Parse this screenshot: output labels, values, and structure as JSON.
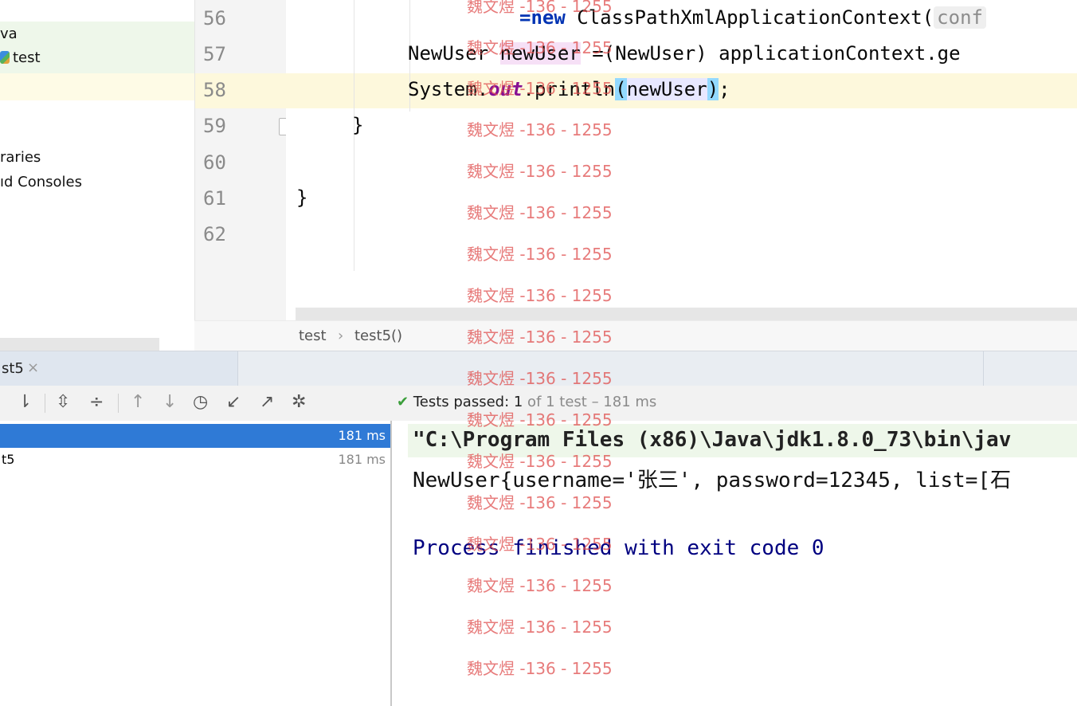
{
  "project_tree": {
    "items": [
      "va",
      "test",
      "raries",
      "ıd Consoles"
    ]
  },
  "editor": {
    "line_numbers": [
      "56",
      "57",
      "58",
      "59",
      "60",
      "61",
      "62"
    ],
    "line56_keyword": "=new",
    "line56_text": " ClassPathXmlApplicationContext(",
    "line56_hint": "conf",
    "line57_type": "NewUser ",
    "line57_var": "newUser",
    "line57_rest": " =(NewUser) applicationContext.ge",
    "line58_prefix": "System.",
    "line58_field": "out",
    "line58_method": ".println",
    "line58_open": "(",
    "line58_arg": "newUser",
    "line58_close": ")",
    "line58_end": ";",
    "line59": "}",
    "line61": "}"
  },
  "breadcrumb": {
    "class": "test",
    "separator": "›",
    "method": "test5()"
  },
  "run_tab": {
    "label": "st5",
    "close": "×"
  },
  "run_toolbar": {
    "icons": [
      "sort-icon",
      "expand-all-icon",
      "collapse-all-icon",
      "up-icon",
      "down-icon",
      "history-icon",
      "import-icon",
      "export-icon",
      "settings-icon"
    ],
    "status_label": "Tests passed: ",
    "status_count": "1",
    "status_rest": " of 1 test – 181 ms"
  },
  "test_tree": {
    "rows": [
      {
        "name": "",
        "time": "181 ms"
      },
      {
        "name": "t5",
        "time": "181 ms"
      }
    ]
  },
  "console": {
    "line1": "\"C:\\Program Files (x86)\\Java\\jdk1.8.0_73\\bin\\jav",
    "line2": "NewUser{username='张三', password=12345, list=[石",
    "line3": "Process finished with exit code 0"
  },
  "watermark": "魏文煜 -136 - 1255",
  "colors": {
    "keyword": "#0033b3",
    "field": "#871094",
    "selection": "#2f7ad6",
    "pass": "#3a9e3a",
    "console_exit": "#000080"
  }
}
